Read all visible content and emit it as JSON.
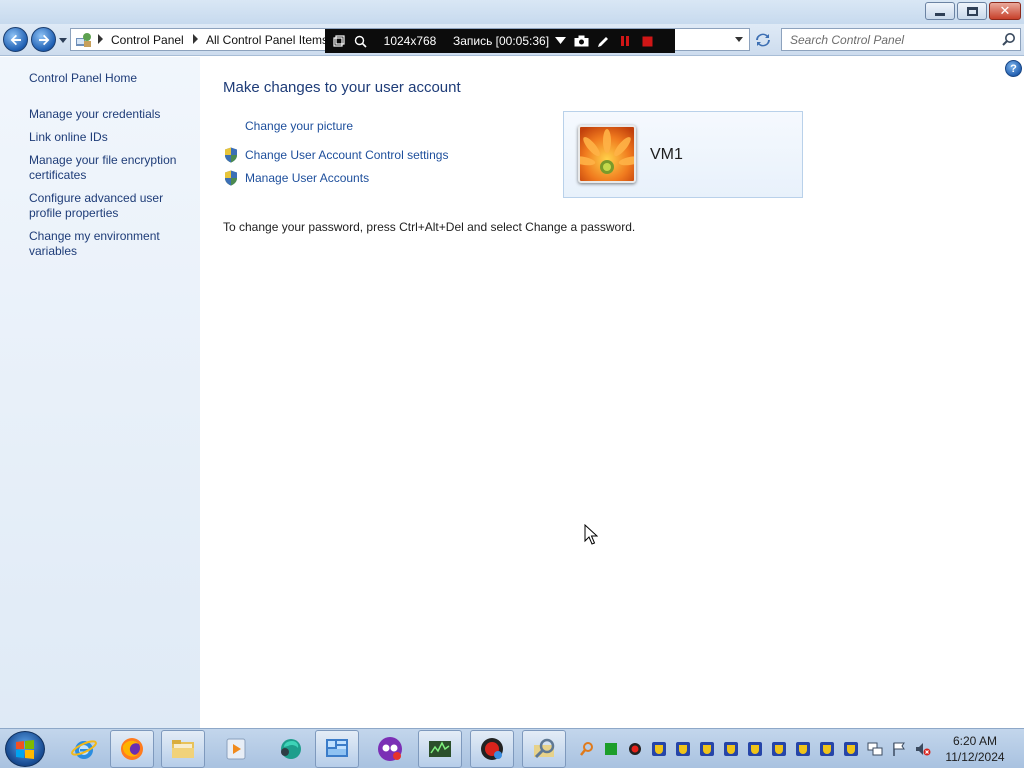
{
  "window": {
    "minimize_label": "minimize",
    "maximize_label": "maximize",
    "close_label": "close"
  },
  "address_bar": {
    "crumbs": [
      "Control Panel",
      "All Control Panel Items"
    ]
  },
  "search": {
    "placeholder": "Search Control Panel"
  },
  "recorder": {
    "size": "1024x768",
    "status": "Запись [00:05:36]"
  },
  "left_pane": {
    "home": "Control Panel Home",
    "links": [
      "Manage your credentials",
      "Link online IDs",
      "Manage your file encryption certificates",
      "Configure advanced user profile properties",
      "Change my environment variables"
    ]
  },
  "main": {
    "title": "Make changes to your user account",
    "links": {
      "picture": "Change your picture",
      "uac": "Change User Account Control settings",
      "accounts": "Manage User Accounts"
    },
    "password_note": "To change your password, press Ctrl+Alt+Del and select Change a password.",
    "user": {
      "name": "VM1"
    }
  },
  "help": {
    "glyph": "?"
  },
  "taskbar": {
    "pinned": [
      "internet-explorer-icon",
      "firefox-icon",
      "file-explorer-icon",
      "media-player-icon",
      "messenger-icon",
      "system-info-icon",
      "game-icon",
      "network-monitor-icon",
      "record-app-icon",
      "control-panel-icon"
    ],
    "clock": {
      "time": "6:20 AM",
      "date": "11/12/2024"
    }
  },
  "colors": {
    "link": "#1e4f9c",
    "title": "#1e3c78",
    "left_pane_top": "#f1f6fc",
    "left_pane_bottom": "#dfeaf6",
    "taskbar": "#b6cbe5",
    "recorder_bg": "#0c0c0c",
    "recorder_stop": "#d01616"
  }
}
